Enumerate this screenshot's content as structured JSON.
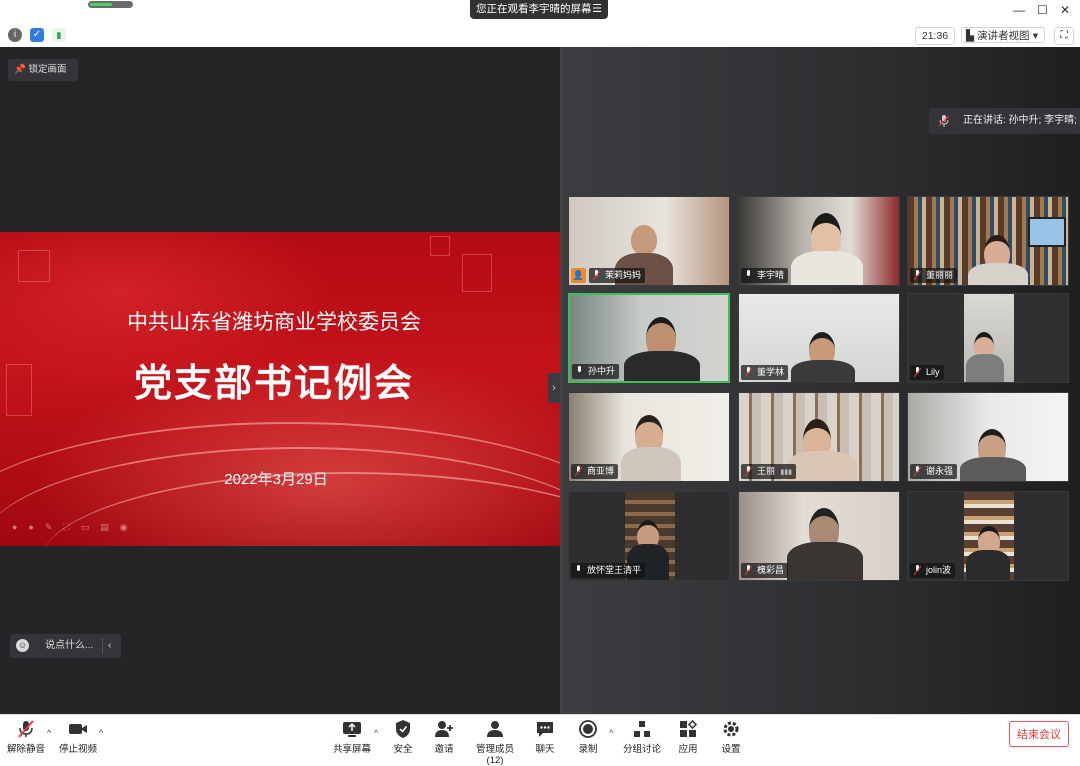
{
  "titlebar": {
    "viewing_banner": "您正在观看李宇晴的屏幕",
    "banner_menu_icon": "menu-icon",
    "minimize": "—",
    "maximize": "☐",
    "close": "✕"
  },
  "infobar": {
    "time": "21:36",
    "view_mode": "演讲者视图",
    "view_caret": "▾"
  },
  "main": {
    "lock_screen": "锁定画面",
    "speaking": "正在讲话: 孙中升; 李宇晴; 放",
    "chat_placeholder": "说点什么...",
    "chat_collapse": "‹",
    "slide_handle": "›"
  },
  "slide": {
    "org": "中共山东省潍坊商业学校委员会",
    "title": "党支部书记例会",
    "date": "2022年3月29日"
  },
  "participants": [
    {
      "name": "茉莉妈妈",
      "host": true
    },
    {
      "name": "李宇晴"
    },
    {
      "name": "董丽丽"
    },
    {
      "name": "孙中升",
      "active": true
    },
    {
      "name": "董学林"
    },
    {
      "name": "Lily"
    },
    {
      "name": "商亚博"
    },
    {
      "name": "王丽",
      "signal": true
    },
    {
      "name": "谢永强"
    },
    {
      "name": "放怀堂王清平"
    },
    {
      "name": "槐彩昌"
    },
    {
      "name": "jolin波"
    }
  ],
  "toolbar": {
    "unmute": "解除静音",
    "stop_video": "停止视频",
    "share": "共享屏幕",
    "security": "安全",
    "invite": "邀请",
    "manage": "管理成员(12)",
    "chat": "聊天",
    "record": "录制",
    "breakout": "分组讨论",
    "apps": "应用",
    "settings": "设置",
    "end": "结束会议",
    "caret": "^"
  },
  "colors": {
    "accent_green": "#3bbf56",
    "end_red": "#e23b3b",
    "slide_red": "#b40b14"
  }
}
